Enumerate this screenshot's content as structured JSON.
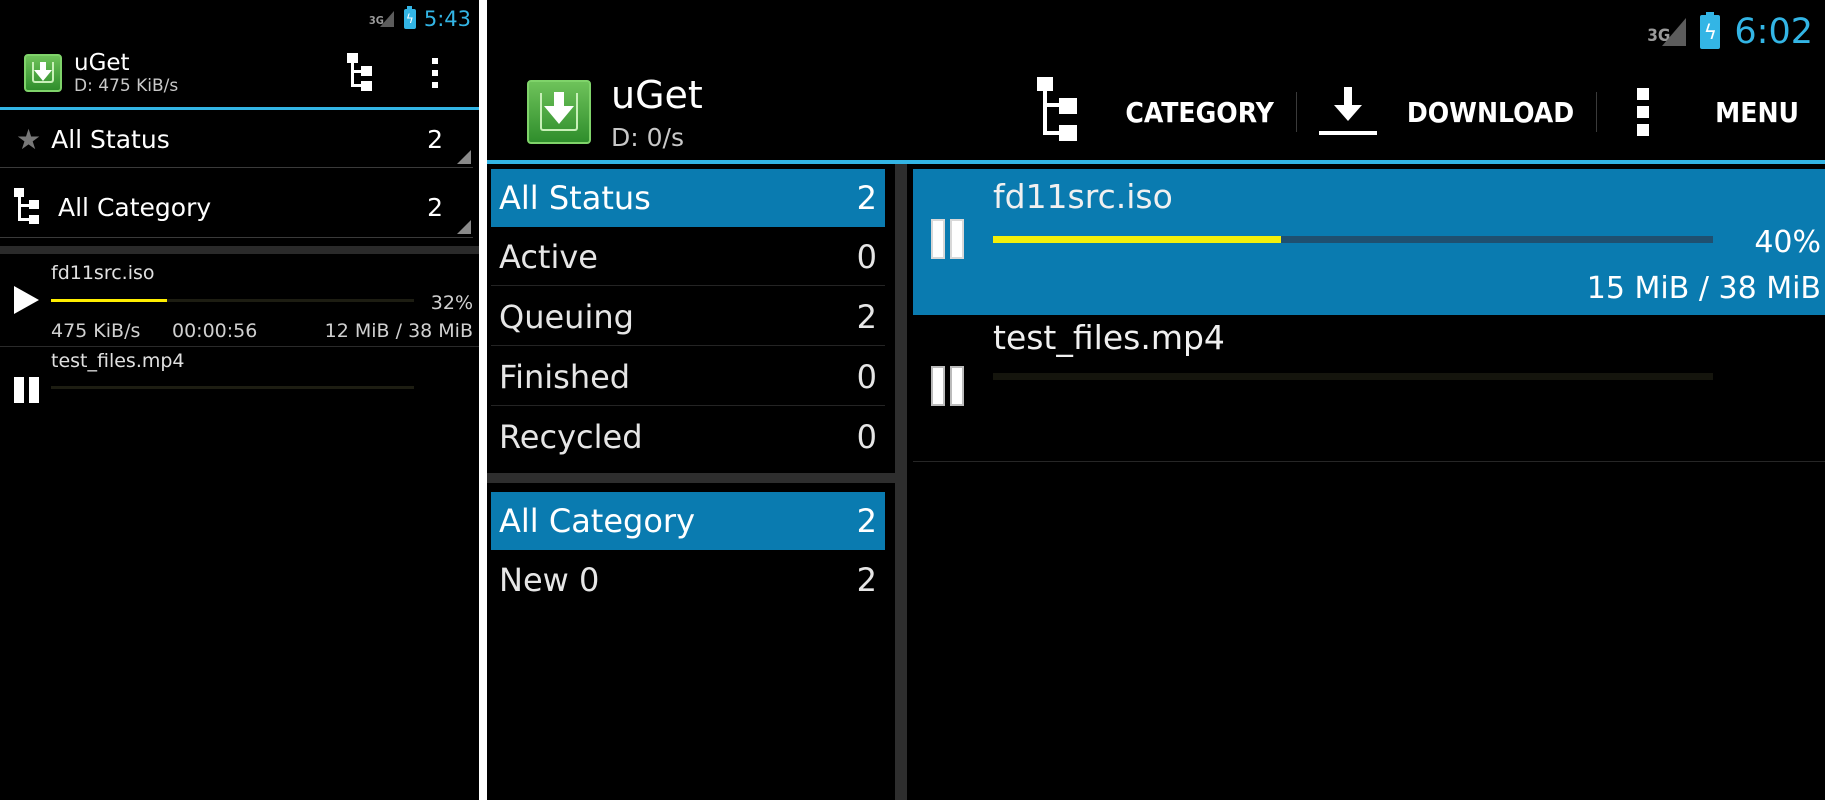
{
  "left": {
    "status_bar": {
      "network": "3G",
      "time": "5:43"
    },
    "action_bar": {
      "title": "uGet",
      "subtitle": "D: 475 KiB/s"
    },
    "spinners": [
      {
        "label": "All Status",
        "count": "2"
      },
      {
        "label": "All Category",
        "count": "2"
      }
    ],
    "downloads": [
      {
        "name": "fd11src.iso",
        "percent": "32%",
        "progress": 0.32,
        "speed": "475 KiB/s",
        "remaining": "00:00:56",
        "size": "12 MiB / 38 MiB",
        "state_icon": "play-icon"
      },
      {
        "name": "test_files.mp4",
        "progress": 0.0,
        "state_icon": "pause-icon"
      }
    ]
  },
  "right": {
    "status_bar": {
      "network": "3G",
      "time": "6:02"
    },
    "action_bar": {
      "title": "uGet",
      "subtitle": "D: 0/s",
      "actions": {
        "category": "CATEGORY",
        "download": "DOWNLOAD",
        "menu": "MENU"
      }
    },
    "status_list": [
      {
        "label": "All Status",
        "count": "2"
      },
      {
        "label": "Active",
        "count": "0"
      },
      {
        "label": "Queuing",
        "count": "2"
      },
      {
        "label": "Finished",
        "count": "0"
      },
      {
        "label": "Recycled",
        "count": "0"
      }
    ],
    "category_list": [
      {
        "label": "All Category",
        "count": "2"
      },
      {
        "label": "New 0",
        "count": "2"
      }
    ],
    "downloads": [
      {
        "name": "fd11src.iso",
        "percent": "40%",
        "progress": 0.4,
        "size": "15 MiB / 38 MiB",
        "state_icon": "pause-icon"
      },
      {
        "name": "test_files.mp4",
        "progress": 0.0,
        "state_icon": "pause-icon"
      }
    ]
  },
  "colors": {
    "accent": "#33b5e5",
    "selection": "#0a7bb0",
    "progress_fill": "#f4f00a",
    "app_icon_green": "#4caf3a"
  }
}
